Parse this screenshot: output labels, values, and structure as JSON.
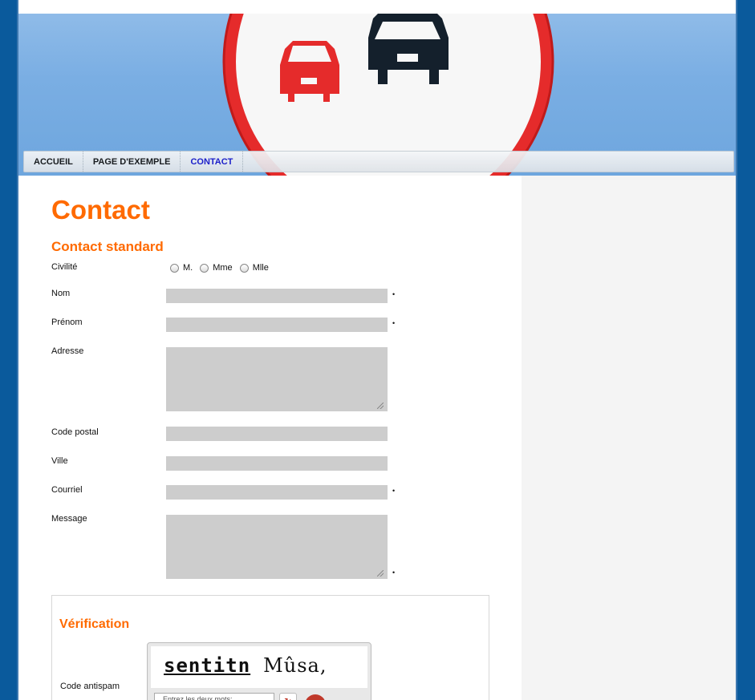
{
  "nav": {
    "items": [
      {
        "label": "ACCUEIL"
      },
      {
        "label": "PAGE D'EXEMPLE"
      },
      {
        "label": "CONTACT"
      }
    ],
    "active_color": "#1414c8"
  },
  "page": {
    "title": "Contact",
    "accent_color": "#ff6a00"
  },
  "form": {
    "heading": "Contact standard",
    "civility": {
      "label": "Civilité",
      "options": [
        "M.",
        "Mme",
        "Mlle"
      ]
    },
    "fields": {
      "nom": {
        "label": "Nom",
        "required_mark": "•"
      },
      "prenom": {
        "label": "Prénom",
        "required_mark": "•"
      },
      "adresse": {
        "label": "Adresse"
      },
      "code_postal": {
        "label": "Code postal"
      },
      "ville": {
        "label": "Ville"
      },
      "courriel": {
        "label": "Courriel",
        "required_mark": "•"
      },
      "message": {
        "label": "Message",
        "required_mark": "•"
      }
    }
  },
  "verification": {
    "heading": "Vérification",
    "antispam_label": "Code antispam",
    "captcha_word1": "sentitn",
    "captcha_word2": "Mûsa,",
    "captcha_input_placeholder": "Entrez les deux mots:",
    "refresh_glyph": "↻"
  }
}
